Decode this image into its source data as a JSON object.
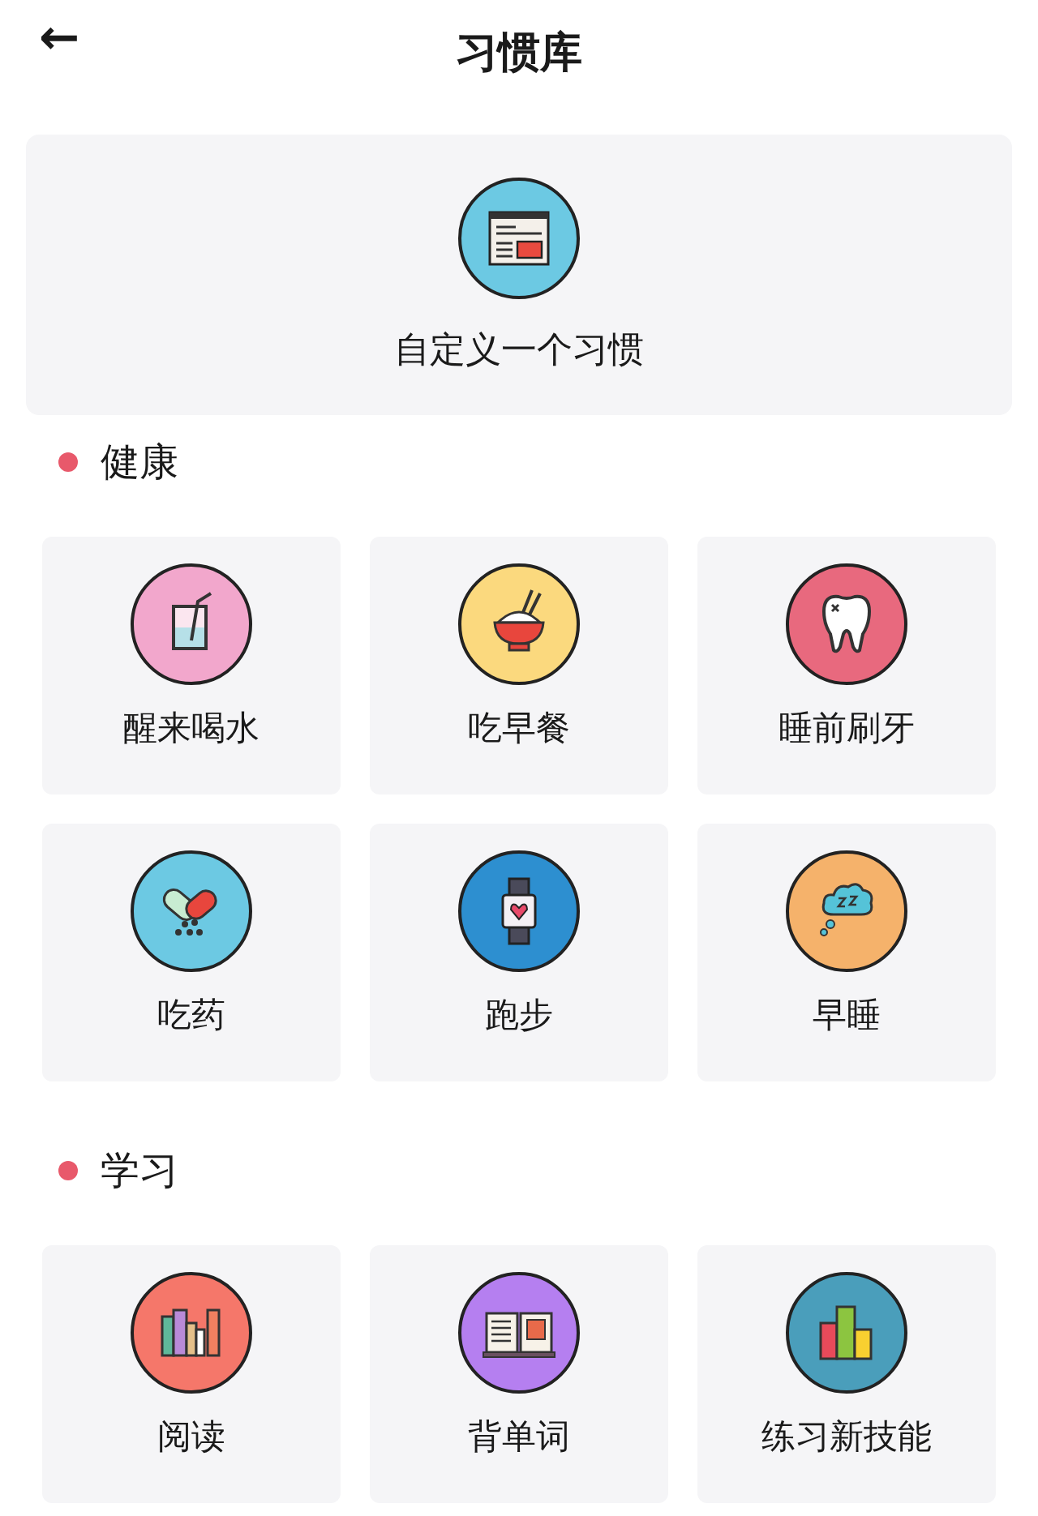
{
  "header": {
    "back": "←",
    "title": "习惯库"
  },
  "custom": {
    "label": "自定义一个习惯",
    "color": "#6cc9e3"
  },
  "sections": [
    {
      "title": "健康",
      "color": "#e8596b",
      "habits": [
        {
          "label": "醒来喝水",
          "color": "#f2a7cc"
        },
        {
          "label": "吃早餐",
          "color": "#fbd97e"
        },
        {
          "label": "睡前刷牙",
          "color": "#e8697e"
        },
        {
          "label": "吃药",
          "color": "#6cc9e3"
        },
        {
          "label": "跑步",
          "color": "#2d8fd0"
        },
        {
          "label": "早睡",
          "color": "#f5b26b"
        }
      ]
    },
    {
      "title": "学习",
      "color": "#e8596b",
      "habits": [
        {
          "label": "阅读",
          "color": "#f5776a"
        },
        {
          "label": "背单词",
          "color": "#b57ff0"
        },
        {
          "label": "练习新技能",
          "color": "#4a9ebb"
        }
      ]
    }
  ]
}
